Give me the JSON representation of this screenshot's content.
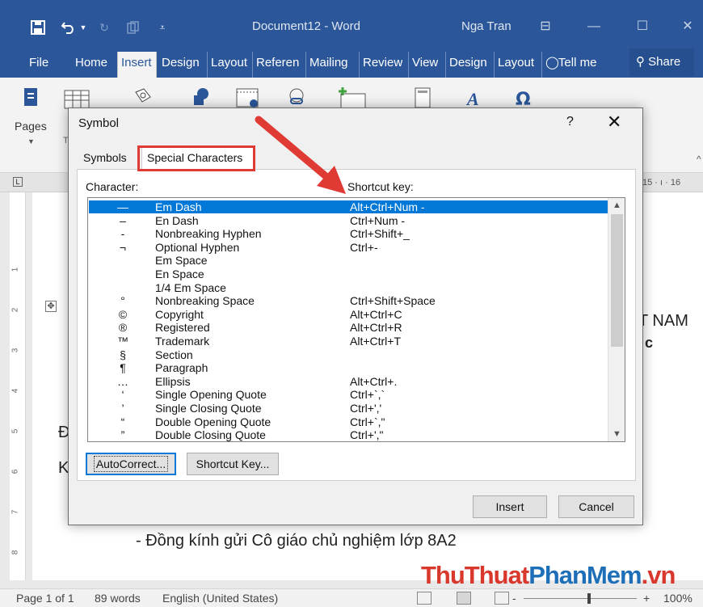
{
  "titlebar": {
    "document_title": "Document12  -  Word",
    "user_name": "Nga Tran"
  },
  "ribbon_tabs": [
    "File",
    "Home",
    "Insert",
    "Design",
    "Layout",
    "Referen",
    "Mailing",
    "Review",
    "View",
    "Design",
    "Layout"
  ],
  "tell_me": "Tell me",
  "share": "Share",
  "ribbon": {
    "pages_label": "Pages"
  },
  "ruler": {
    "numbers": "15 · ı · 16"
  },
  "document": {
    "text_1": "T NAM",
    "text_2": "c",
    "text_3": "Đ",
    "text_4": "K",
    "text_5": "- Đồng kính gửi Cô giáo chủ nghiệm lớp 8A2"
  },
  "status": {
    "page": "Page 1 of 1",
    "words": "89 words",
    "language": "English (United States)",
    "zoom": "100%",
    "zoom_minus": "-",
    "zoom_plus": "+"
  },
  "watermark": {
    "part_a": "ThuThuat",
    "part_b": "PhanMem",
    "part_c": ".vn"
  },
  "dialog": {
    "title": "Symbol",
    "help": "?",
    "close": "✕",
    "tabs": {
      "symbols": "Symbols",
      "special": "Special Characters"
    },
    "col_character": "Character:",
    "col_shortcut": "Shortcut key:",
    "rows": [
      {
        "char": "—",
        "name": "Em Dash",
        "key": "Alt+Ctrl+Num -"
      },
      {
        "char": "–",
        "name": "En Dash",
        "key": "Ctrl+Num -"
      },
      {
        "char": "-",
        "name": "Nonbreaking Hyphen",
        "key": "Ctrl+Shift+_"
      },
      {
        "char": "¬",
        "name": "Optional Hyphen",
        "key": "Ctrl+-"
      },
      {
        "char": "",
        "name": "Em Space",
        "key": ""
      },
      {
        "char": "",
        "name": "En Space",
        "key": ""
      },
      {
        "char": "",
        "name": "1/4 Em Space",
        "key": ""
      },
      {
        "char": "°",
        "name": "Nonbreaking Space",
        "key": "Ctrl+Shift+Space"
      },
      {
        "char": "©",
        "name": "Copyright",
        "key": "Alt+Ctrl+C"
      },
      {
        "char": "®",
        "name": "Registered",
        "key": "Alt+Ctrl+R"
      },
      {
        "char": "™",
        "name": "Trademark",
        "key": "Alt+Ctrl+T"
      },
      {
        "char": "§",
        "name": "Section",
        "key": ""
      },
      {
        "char": "¶",
        "name": "Paragraph",
        "key": ""
      },
      {
        "char": "…",
        "name": "Ellipsis",
        "key": "Alt+Ctrl+."
      },
      {
        "char": "‘",
        "name": "Single Opening Quote",
        "key": "Ctrl+`,`"
      },
      {
        "char": "’",
        "name": "Single Closing Quote",
        "key": "Ctrl+','"
      },
      {
        "char": "“",
        "name": "Double Opening Quote",
        "key": "Ctrl+`,\""
      },
      {
        "char": "”",
        "name": "Double Closing Quote",
        "key": "Ctrl+',\""
      }
    ],
    "buttons": {
      "autocorrect": "AutoCorrect...",
      "shortcut_key": "Shortcut Key...",
      "insert": "Insert",
      "cancel": "Cancel"
    }
  },
  "colors": {
    "word_blue": "#2b579a",
    "selection": "#0078d7",
    "annotation_red": "#e03a35"
  }
}
